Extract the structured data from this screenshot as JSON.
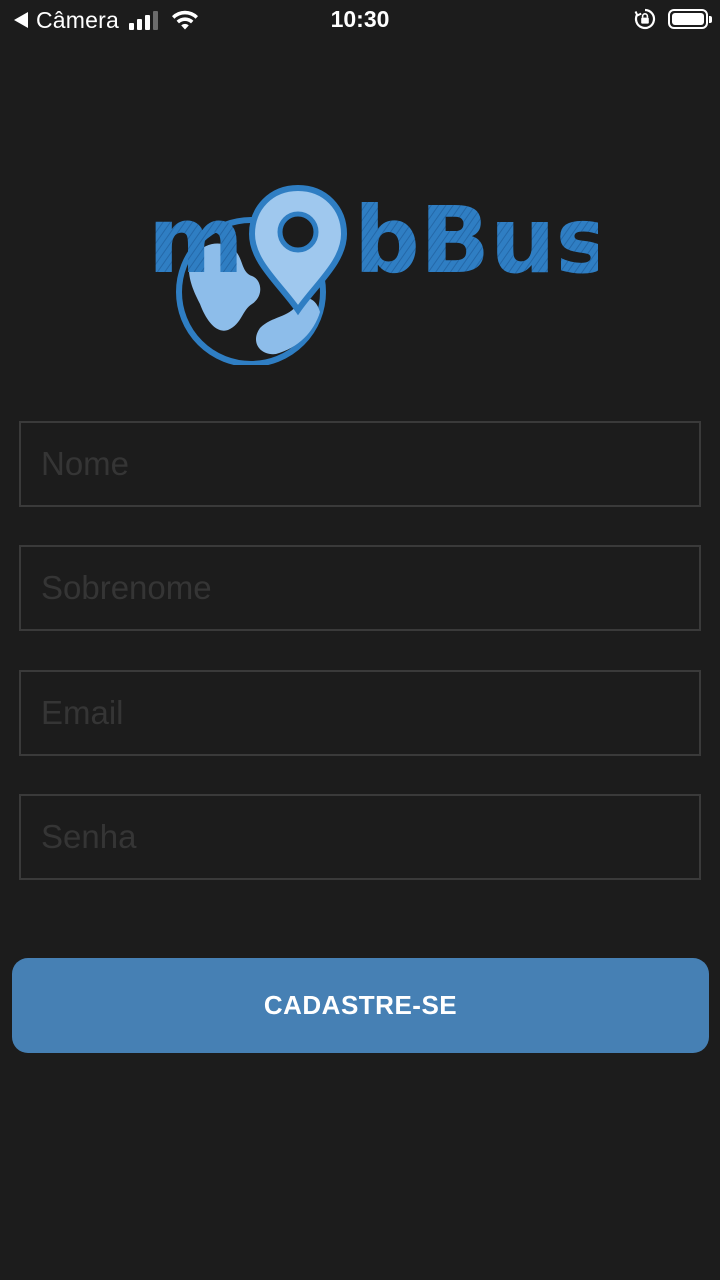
{
  "status_bar": {
    "back_label": "Câmera",
    "time": "10:30",
    "signal_bars_active": 3,
    "signal_bars_total": 4,
    "battery_level": 1.0,
    "icons": [
      "back-arrow-icon",
      "signal-icon",
      "wifi-icon",
      "orientation-lock-icon",
      "battery-icon"
    ]
  },
  "logo": {
    "text": "mobBus",
    "icons": [
      "globe-icon",
      "map-pin-icon"
    ],
    "color": "#2e7fc4"
  },
  "form": {
    "fields": [
      {
        "placeholder": "Nome",
        "value": "",
        "type": "text"
      },
      {
        "placeholder": "Sobrenome",
        "value": "",
        "type": "text"
      },
      {
        "placeholder": "Email",
        "value": "",
        "type": "email"
      },
      {
        "placeholder": "Senha",
        "value": "",
        "type": "password"
      }
    ],
    "submit_label": "CADASTRE-SE"
  },
  "colors": {
    "background": "#1c1c1c",
    "button": "#4680b4",
    "field_border": "#3a3a3a",
    "placeholder": "#353535"
  }
}
